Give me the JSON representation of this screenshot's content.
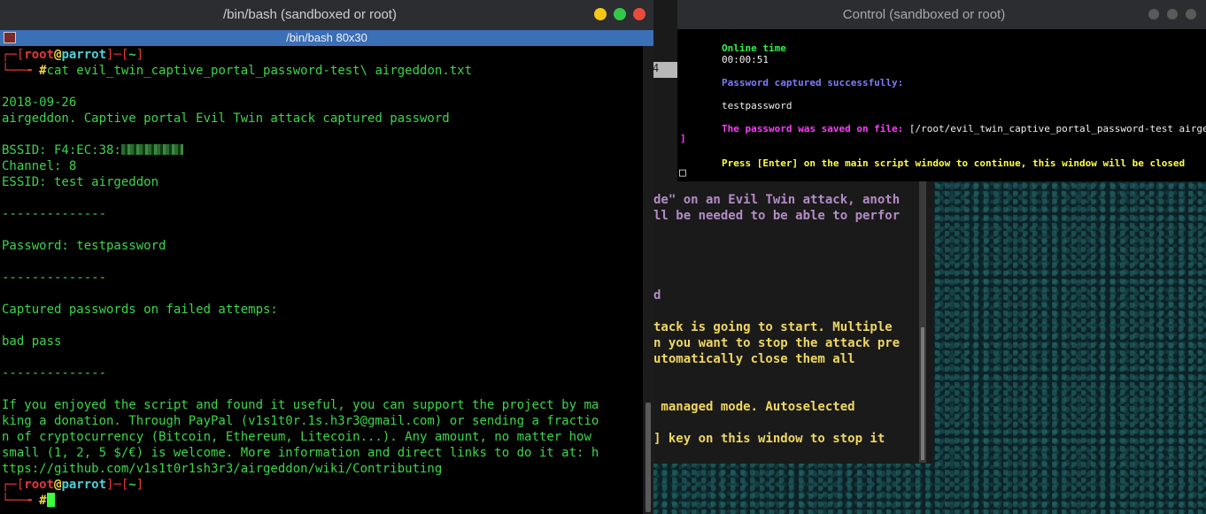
{
  "left_window": {
    "title": "/bin/bash (sandboxed or root)",
    "tab_title": "/bin/bash 80x30",
    "prompt": {
      "open": "┌─[",
      "user": "root",
      "at": "@",
      "host": "parrot",
      "mid": "]─[",
      "path": "~",
      "close": "]",
      "arrow": "└──╼ ",
      "hash": "#"
    },
    "command": "cat evil_twin_captive_portal_password-test\\ airgeddon.txt",
    "output": [
      "2018-09-26",
      "airgeddon. Captive portal Evil Twin attack captured password",
      "",
      "BSSID: F4:EC:38:",
      "Channel: 8",
      "ESSID: test airgeddon",
      "",
      "--------------",
      "",
      "Password: testpassword",
      "",
      "--------------",
      "",
      "Captured passwords on failed attemps:",
      "",
      "bad pass",
      "",
      "--------------",
      "",
      "If you enjoyed the script and found it useful, you can support the project by ma",
      "king a donation. Through PayPal (v1s1t0r.1s.h3r3@gmail.com) or sending a fractio",
      "n of cryptocurrency (Bitcoin, Ethereum, Litecoin...). Any amount, no matter how",
      "small (1, 2, 5 $/€) is welcome. More information and direct links to do it at: h",
      "ttps://github.com/v1s1t0r1sh3r3/airgeddon/wiki/Contributing"
    ]
  },
  "right_window": {
    "title": "Control (sandboxed or root)",
    "online_label": "Online time",
    "online_value": "00:00:51",
    "captured": "Password captured successfully:",
    "password": "testpassword",
    "saved_label": "The password was saved on file: ",
    "saved_path": "[/root/evil_twin_captive_portal_password-test airgeddon.txt",
    "press_enter": "Press [Enter] on the main script window to continue, this window will be closed"
  },
  "back_window": {
    "tab_stub": "4",
    "lines_purple": [
      "de\" on an Evil Twin attack, anoth",
      "ll be needed to be able to perfor",
      "d"
    ],
    "lines_yellow": [
      "tack is going to start. Multiple",
      "n you want to stop the attack pre",
      "utomatically close them all",
      " managed mode. Autoselected",
      "] key on this window to stop it"
    ],
    "bracket": "]",
    "box": "□"
  },
  "colors": {
    "terminal_green": "#3cd64a",
    "prompt_red": "#e4393a",
    "tab_blue": "#3b6fb6",
    "close_red": "#e94b3c",
    "min_yellow": "#f5c518",
    "max_green": "#34c749"
  }
}
